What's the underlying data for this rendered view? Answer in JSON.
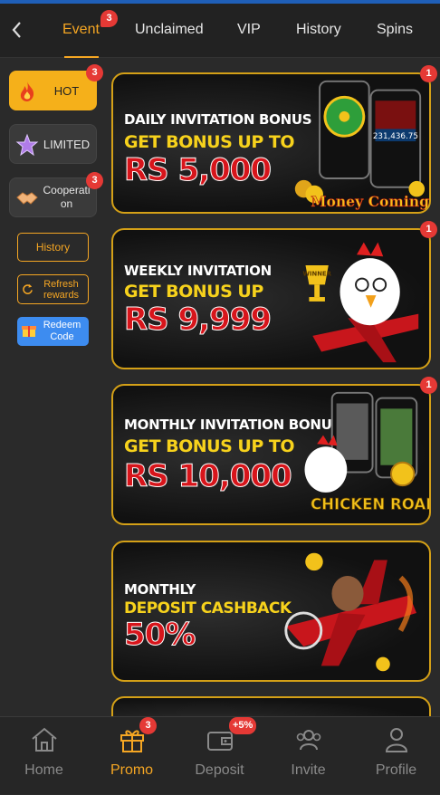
{
  "header": {
    "tabs": [
      {
        "label": "Event",
        "badge": "3",
        "active": true
      },
      {
        "label": "Unclaimed"
      },
      {
        "label": "VIP"
      },
      {
        "label": "History"
      },
      {
        "label": "Spins"
      }
    ]
  },
  "sidebar": {
    "items": [
      {
        "label": "HOT",
        "badge": "3",
        "icon": "fire-icon",
        "active": true
      },
      {
        "label": "LIMITED",
        "icon": "star-icon"
      },
      {
        "label": "Cooperati on",
        "badge": "3",
        "icon": "handshake-icon"
      }
    ],
    "history_label": "History",
    "refresh_label": "Refresh rewards",
    "redeem_label": "Redeem Code"
  },
  "banners": [
    {
      "line1": "DAILY INVITATION BONUS",
      "line2": "GET BONUS UP TO",
      "line3": "RS 5,000",
      "badge": "1",
      "art_text": "Money Coming",
      "art_sub": "231,436.75"
    },
    {
      "line1": "WEEKLY INVITATION",
      "line2": "GET BONUS UP",
      "line3": "RS 9,999",
      "badge": "1",
      "art_text": "WINNER"
    },
    {
      "line1": "MONTHLY INVITATION BONUS",
      "line2": "GET BONUS UP TO",
      "line3": "RS 10,000",
      "badge": "1",
      "art_text": "CHICKEN ROAD"
    },
    {
      "line1": "MONTHLY",
      "line2": "DEPOSIT CASHBACK",
      "line3": "50%"
    }
  ],
  "bottom_nav": [
    {
      "label": "Home",
      "icon": "home-icon"
    },
    {
      "label": "Promo",
      "icon": "gift-icon",
      "badge": "3",
      "active": true
    },
    {
      "label": "Deposit",
      "icon": "wallet-icon",
      "badge": "+5%"
    },
    {
      "label": "Invite",
      "icon": "invite-icon"
    },
    {
      "label": "Profile",
      "icon": "profile-icon"
    }
  ],
  "colors": {
    "accent": "#f5a623",
    "badge": "#e53935",
    "banner_border": "#d4a017",
    "redeem": "#3d8cf0"
  }
}
